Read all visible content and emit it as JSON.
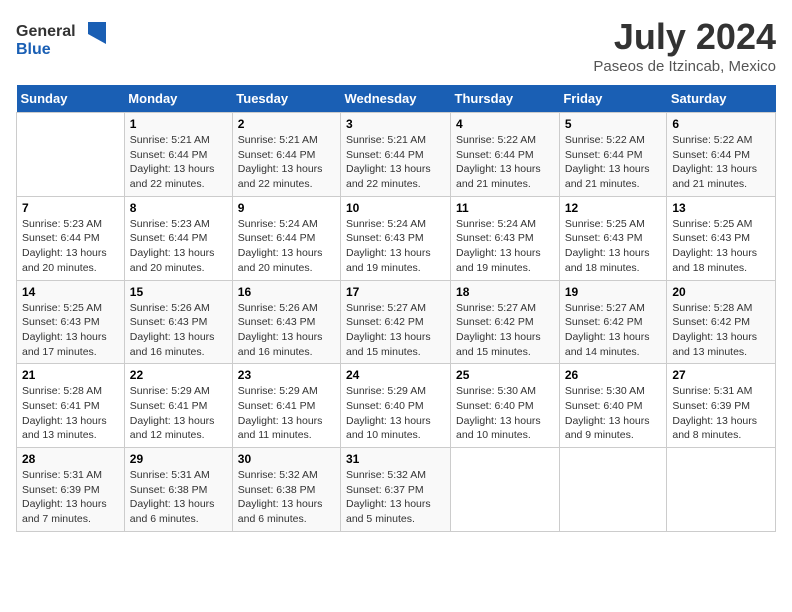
{
  "header": {
    "logo_general": "General",
    "logo_blue": "Blue",
    "main_title": "July 2024",
    "subtitle": "Paseos de Itzincab, Mexico"
  },
  "calendar": {
    "days_of_week": [
      "Sunday",
      "Monday",
      "Tuesday",
      "Wednesday",
      "Thursday",
      "Friday",
      "Saturday"
    ],
    "weeks": [
      [
        {
          "day": "",
          "info": ""
        },
        {
          "day": "1",
          "info": "Sunrise: 5:21 AM\nSunset: 6:44 PM\nDaylight: 13 hours\nand 22 minutes."
        },
        {
          "day": "2",
          "info": "Sunrise: 5:21 AM\nSunset: 6:44 PM\nDaylight: 13 hours\nand 22 minutes."
        },
        {
          "day": "3",
          "info": "Sunrise: 5:21 AM\nSunset: 6:44 PM\nDaylight: 13 hours\nand 22 minutes."
        },
        {
          "day": "4",
          "info": "Sunrise: 5:22 AM\nSunset: 6:44 PM\nDaylight: 13 hours\nand 21 minutes."
        },
        {
          "day": "5",
          "info": "Sunrise: 5:22 AM\nSunset: 6:44 PM\nDaylight: 13 hours\nand 21 minutes."
        },
        {
          "day": "6",
          "info": "Sunrise: 5:22 AM\nSunset: 6:44 PM\nDaylight: 13 hours\nand 21 minutes."
        }
      ],
      [
        {
          "day": "7",
          "info": "Sunrise: 5:23 AM\nSunset: 6:44 PM\nDaylight: 13 hours\nand 20 minutes."
        },
        {
          "day": "8",
          "info": "Sunrise: 5:23 AM\nSunset: 6:44 PM\nDaylight: 13 hours\nand 20 minutes."
        },
        {
          "day": "9",
          "info": "Sunrise: 5:24 AM\nSunset: 6:44 PM\nDaylight: 13 hours\nand 20 minutes."
        },
        {
          "day": "10",
          "info": "Sunrise: 5:24 AM\nSunset: 6:43 PM\nDaylight: 13 hours\nand 19 minutes."
        },
        {
          "day": "11",
          "info": "Sunrise: 5:24 AM\nSunset: 6:43 PM\nDaylight: 13 hours\nand 19 minutes."
        },
        {
          "day": "12",
          "info": "Sunrise: 5:25 AM\nSunset: 6:43 PM\nDaylight: 13 hours\nand 18 minutes."
        },
        {
          "day": "13",
          "info": "Sunrise: 5:25 AM\nSunset: 6:43 PM\nDaylight: 13 hours\nand 18 minutes."
        }
      ],
      [
        {
          "day": "14",
          "info": "Sunrise: 5:25 AM\nSunset: 6:43 PM\nDaylight: 13 hours\nand 17 minutes."
        },
        {
          "day": "15",
          "info": "Sunrise: 5:26 AM\nSunset: 6:43 PM\nDaylight: 13 hours\nand 16 minutes."
        },
        {
          "day": "16",
          "info": "Sunrise: 5:26 AM\nSunset: 6:43 PM\nDaylight: 13 hours\nand 16 minutes."
        },
        {
          "day": "17",
          "info": "Sunrise: 5:27 AM\nSunset: 6:42 PM\nDaylight: 13 hours\nand 15 minutes."
        },
        {
          "day": "18",
          "info": "Sunrise: 5:27 AM\nSunset: 6:42 PM\nDaylight: 13 hours\nand 15 minutes."
        },
        {
          "day": "19",
          "info": "Sunrise: 5:27 AM\nSunset: 6:42 PM\nDaylight: 13 hours\nand 14 minutes."
        },
        {
          "day": "20",
          "info": "Sunrise: 5:28 AM\nSunset: 6:42 PM\nDaylight: 13 hours\nand 13 minutes."
        }
      ],
      [
        {
          "day": "21",
          "info": "Sunrise: 5:28 AM\nSunset: 6:41 PM\nDaylight: 13 hours\nand 13 minutes."
        },
        {
          "day": "22",
          "info": "Sunrise: 5:29 AM\nSunset: 6:41 PM\nDaylight: 13 hours\nand 12 minutes."
        },
        {
          "day": "23",
          "info": "Sunrise: 5:29 AM\nSunset: 6:41 PM\nDaylight: 13 hours\nand 11 minutes."
        },
        {
          "day": "24",
          "info": "Sunrise: 5:29 AM\nSunset: 6:40 PM\nDaylight: 13 hours\nand 10 minutes."
        },
        {
          "day": "25",
          "info": "Sunrise: 5:30 AM\nSunset: 6:40 PM\nDaylight: 13 hours\nand 10 minutes."
        },
        {
          "day": "26",
          "info": "Sunrise: 5:30 AM\nSunset: 6:40 PM\nDaylight: 13 hours\nand 9 minutes."
        },
        {
          "day": "27",
          "info": "Sunrise: 5:31 AM\nSunset: 6:39 PM\nDaylight: 13 hours\nand 8 minutes."
        }
      ],
      [
        {
          "day": "28",
          "info": "Sunrise: 5:31 AM\nSunset: 6:39 PM\nDaylight: 13 hours\nand 7 minutes."
        },
        {
          "day": "29",
          "info": "Sunrise: 5:31 AM\nSunset: 6:38 PM\nDaylight: 13 hours\nand 6 minutes."
        },
        {
          "day": "30",
          "info": "Sunrise: 5:32 AM\nSunset: 6:38 PM\nDaylight: 13 hours\nand 6 minutes."
        },
        {
          "day": "31",
          "info": "Sunrise: 5:32 AM\nSunset: 6:37 PM\nDaylight: 13 hours\nand 5 minutes."
        },
        {
          "day": "",
          "info": ""
        },
        {
          "day": "",
          "info": ""
        },
        {
          "day": "",
          "info": ""
        }
      ]
    ]
  }
}
